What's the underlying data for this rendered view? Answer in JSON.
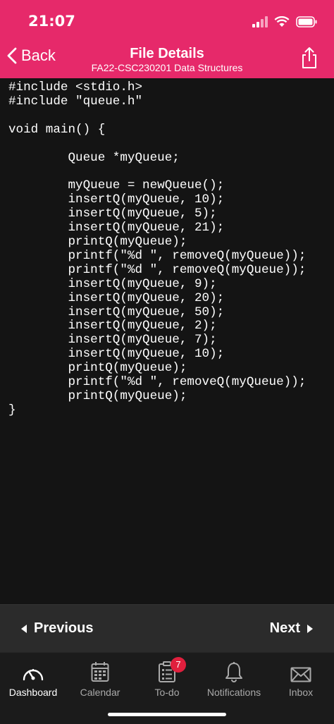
{
  "status_bar": {
    "time": "21:07"
  },
  "header": {
    "back_label": "Back",
    "title": "File Details",
    "subtitle": "FA22-CSC230201 Data Structures"
  },
  "code_lines": [
    "#include <stdio.h>",
    "#include \"queue.h\"",
    "",
    "void main() {",
    "",
    "        Queue *myQueue;",
    "",
    "        myQueue = newQueue();",
    "        insertQ(myQueue, 10);",
    "        insertQ(myQueue, 5);",
    "        insertQ(myQueue, 21);",
    "        printQ(myQueue);",
    "        printf(\"%d \", removeQ(myQueue));",
    "        printf(\"%d \", removeQ(myQueue));",
    "        insertQ(myQueue, 9);",
    "        insertQ(myQueue, 20);",
    "        insertQ(myQueue, 50);",
    "        insertQ(myQueue, 2);",
    "        insertQ(myQueue, 7);",
    "        insertQ(myQueue, 10);",
    "        printQ(myQueue);",
    "        printf(\"%d \", removeQ(myQueue));",
    "        printQ(myQueue);",
    "}"
  ],
  "pager": {
    "previous_label": "Previous",
    "next_label": "Next"
  },
  "tabbar": {
    "items": [
      {
        "label": "Dashboard",
        "icon": "dashboard-gauge-icon",
        "active": true
      },
      {
        "label": "Calendar",
        "icon": "calendar-icon",
        "active": false
      },
      {
        "label": "To-do",
        "icon": "todo-clipboard-icon",
        "active": false,
        "badge": "7"
      },
      {
        "label": "Notifications",
        "icon": "bell-icon",
        "active": false
      },
      {
        "label": "Inbox",
        "icon": "envelope-icon",
        "active": false
      }
    ]
  },
  "colors": {
    "header": "#E6296A",
    "badge": "#E01F3D",
    "background": "#141414"
  }
}
